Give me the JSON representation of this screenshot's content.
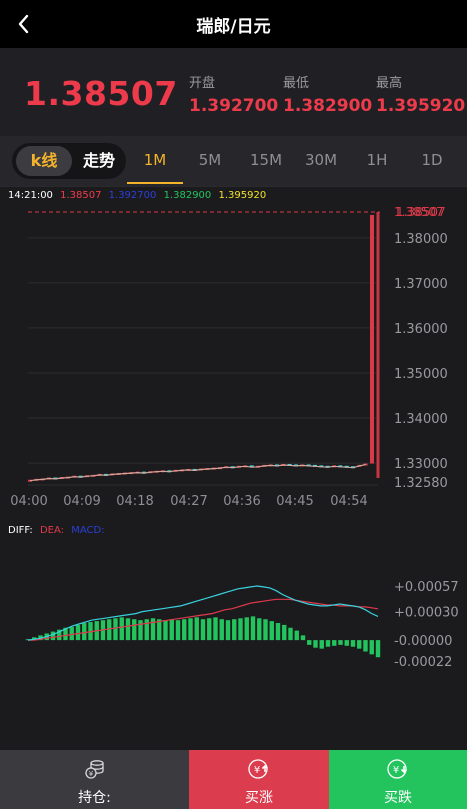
{
  "header": {
    "title": "瑞郎/日元",
    "back_icon": "chevron-left-icon"
  },
  "quote": {
    "price": "1.38507",
    "stats": [
      {
        "label": "开盘",
        "value": "1.392700"
      },
      {
        "label": "最低",
        "value": "1.382900"
      },
      {
        "label": "最高",
        "value": "1.395920"
      }
    ]
  },
  "modes": {
    "kline": "k线",
    "trend": "走势"
  },
  "timeframes": [
    "1M",
    "5M",
    "15M",
    "30M",
    "1H",
    "1D"
  ],
  "active_timeframe": "1M",
  "legend": {
    "time": "14:21:00",
    "close": "1.38507",
    "open": "1.392700",
    "low": "1.382900",
    "high": "1.395920"
  },
  "macd_legend": {
    "diff": "DIFF:",
    "dea": "DEA:",
    "macd": "MACD:"
  },
  "colors": {
    "accent": "#f3b32b",
    "up": "#ee3b4b",
    "down": "#23c45e",
    "diff": "#39d3e0",
    "dea": "#e0394b"
  },
  "chart_data": [
    {
      "type": "candlestick",
      "y_ticks": [
        "1.38000",
        "1.37000",
        "1.36000",
        "1.35000",
        "1.34000",
        "1.33000",
        "1.32580"
      ],
      "x_ticks": [
        "04:00",
        "04:09",
        "04:18",
        "04:27",
        "04:36",
        "04:45",
        "04:54"
      ],
      "ylim": [
        1.3258,
        1.38507
      ],
      "last_price_label": "1.38507",
      "highest_marker": "1.38507",
      "closes": [
        1.3263,
        1.3265,
        1.3266,
        1.3268,
        1.3267,
        1.3269,
        1.327,
        1.3272,
        1.3271,
        1.3273,
        1.3274,
        1.3276,
        1.3275,
        1.3277,
        1.3278,
        1.3279,
        1.328,
        1.3281,
        1.328,
        1.3282,
        1.3283,
        1.3284,
        1.3283,
        1.3285,
        1.3286,
        1.3287,
        1.3286,
        1.3288,
        1.3289,
        1.329,
        1.3291,
        1.3293,
        1.3292,
        1.3294,
        1.3295,
        1.3293,
        1.3294,
        1.3296,
        1.3297,
        1.3296,
        1.3298,
        1.3297,
        1.3296,
        1.3297,
        1.3296,
        1.3295,
        1.3294,
        1.3293,
        1.3295,
        1.3294,
        1.3293,
        1.3292,
        1.3296,
        1.3299,
        1.38507
      ]
    },
    {
      "type": "macd",
      "y_ticks": [
        "+0.00057",
        "+0.00030",
        "-0.00000",
        "-0.00022"
      ],
      "ylim": [
        -0.00022,
        0.00057
      ],
      "hist": [
        1e-05,
        3e-05,
        5e-05,
        7e-05,
        9e-05,
        0.00011,
        0.00013,
        0.00014,
        0.00016,
        0.00018,
        0.00019,
        0.0002,
        0.00021,
        0.00022,
        0.00023,
        0.00024,
        0.00023,
        0.00022,
        0.00021,
        0.00022,
        0.00023,
        0.00022,
        0.00021,
        0.00022,
        0.00021,
        0.00022,
        0.00023,
        0.00024,
        0.00022,
        0.00023,
        0.00024,
        0.00022,
        0.00021,
        0.00022,
        0.00023,
        0.00024,
        0.00025,
        0.00023,
        0.00022,
        0.0002,
        0.00018,
        0.00016,
        0.00013,
        0.0001,
        5e-05,
        -5e-05,
        -8e-05,
        -9e-05,
        -7e-05,
        -6e-05,
        -5e-05,
        -6e-05,
        -7e-05,
        -9e-05,
        -0.00012,
        -0.00015,
        -0.00018
      ],
      "diff": [
        0.0,
        1e-05,
        2e-05,
        4e-05,
        6e-05,
        9e-05,
        0.00012,
        0.00015,
        0.00017,
        0.00019,
        0.00021,
        0.00022,
        0.00023,
        0.00024,
        0.00025,
        0.00026,
        0.00027,
        0.00028,
        0.0003,
        0.00031,
        0.00032,
        0.00033,
        0.00034,
        0.00035,
        0.00036,
        0.00038,
        0.0004,
        0.00042,
        0.00044,
        0.00046,
        0.00048,
        0.0005,
        0.00052,
        0.00054,
        0.00055,
        0.00056,
        0.00057,
        0.00056,
        0.00055,
        0.00052,
        0.00048,
        0.00045,
        0.00042,
        0.0004,
        0.00038,
        0.00037,
        0.00036,
        0.00036,
        0.00037,
        0.00038,
        0.00037,
        0.00036,
        0.00035,
        0.00032,
        0.00028,
        0.00025
      ],
      "dea": [
        0.0,
        0.0,
        1e-05,
        2e-05,
        3e-05,
        4e-05,
        5e-05,
        6e-05,
        7e-05,
        8e-05,
        9e-05,
        0.0001,
        0.00011,
        0.00012,
        0.00013,
        0.00014,
        0.00015,
        0.00016,
        0.00017,
        0.00018,
        0.00019,
        0.0002,
        0.00021,
        0.00022,
        0.00023,
        0.00024,
        0.00025,
        0.00026,
        0.00027,
        0.00028,
        0.0003,
        0.00032,
        0.00033,
        0.00035,
        0.00037,
        0.00039,
        0.0004,
        0.00041,
        0.00042,
        0.00043,
        0.00043,
        0.00043,
        0.00042,
        0.00041,
        0.0004,
        0.00039,
        0.00038,
        0.00037,
        0.00037,
        0.00036,
        0.00036,
        0.00036,
        0.00035,
        0.00035,
        0.00034,
        0.00033
      ]
    }
  ],
  "bottom": {
    "position_label": "持仓:",
    "buy_up_label": "买涨",
    "buy_down_label": "买跌",
    "position_icon": "coins-icon",
    "up_icon": "yen-up-icon",
    "down_icon": "yen-down-icon"
  }
}
